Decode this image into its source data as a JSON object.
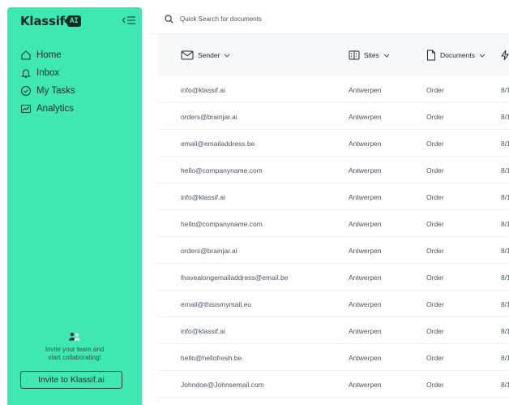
{
  "app": {
    "brand_name": "Klassif",
    "brand_badge": "AI",
    "colors": {
      "sidebar": "#3ee8b0",
      "brand_dark": "#0f2a25"
    }
  },
  "sidebar": {
    "items": [
      {
        "label": "Home",
        "icon": "home-icon"
      },
      {
        "label": "Inbox",
        "icon": "bell-icon"
      },
      {
        "label": "My Tasks",
        "icon": "check-circle-icon"
      },
      {
        "label": "Analytics",
        "icon": "analytics-icon"
      }
    ],
    "invite_text_line1": "Invite your team and",
    "invite_text_line2": "start collaborating!",
    "invite_button": "Invite to Klassif.ai"
  },
  "search": {
    "placeholder": "Quick Search for documents"
  },
  "table": {
    "columns": [
      {
        "label": "Sender",
        "icon": "mail-icon"
      },
      {
        "label": "Sites",
        "icon": "building-icon"
      },
      {
        "label": "Documents",
        "icon": "document-icon"
      },
      {
        "label": "",
        "icon": "lightning-icon"
      }
    ],
    "rows": [
      {
        "sender": "info@klassif.ai",
        "site": "Antwerpen",
        "document": "Order",
        "date": "8/1"
      },
      {
        "sender": "orders@brainjar.ai",
        "site": "Antwerpen",
        "document": "Order",
        "date": "8/1"
      },
      {
        "sender": "email@emailaddress.be",
        "site": "Antwerpen",
        "document": "Order",
        "date": "8/1"
      },
      {
        "sender": "hello@companyname.com",
        "site": "Antwerpen",
        "document": "Order",
        "date": "8/1"
      },
      {
        "sender": "info@klassif.ai",
        "site": "Antwerpen",
        "document": "Order",
        "date": "8/1"
      },
      {
        "sender": "hello@companyname.com",
        "site": "Antwerpen",
        "document": "Order",
        "date": "8/1"
      },
      {
        "sender": "orders@brainjar.ai",
        "site": "Antwerpen",
        "document": "Order",
        "date": "8/1"
      },
      {
        "sender": "lhavealongemailaddress@email.be",
        "site": "Antwerpen",
        "document": "Order",
        "date": "8/1"
      },
      {
        "sender": "email@thisismymail.eu",
        "site": "Antwerpen",
        "document": "Order",
        "date": "8/1"
      },
      {
        "sender": "info@klassif.ai",
        "site": "Antwerpen",
        "document": "Order",
        "date": "8/1"
      },
      {
        "sender": "hello@hellofresh.be",
        "site": "Antwerpen",
        "document": "Order",
        "date": "8/1"
      },
      {
        "sender": "Johndoe@Johnsemail.com",
        "site": "Antwerpen",
        "document": "Order",
        "date": "8/1"
      }
    ]
  }
}
